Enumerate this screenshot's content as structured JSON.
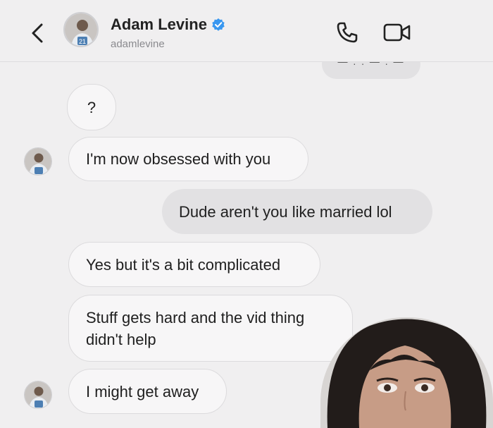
{
  "header": {
    "contact_name": "Adam Levine",
    "handle": "adamlevine",
    "back_icon": "chevron-left-icon",
    "verified_icon": "verified-badge-icon",
    "call_icon": "phone-icon",
    "video_icon": "video-camera-icon",
    "verified_color": "#3897f0"
  },
  "thread": {
    "messages": [
      {
        "side": "in",
        "text": "?"
      },
      {
        "side": "in",
        "text": "I'm now obsessed with you"
      },
      {
        "side": "out",
        "text": "Dude aren't you like married lol"
      },
      {
        "side": "in",
        "text": "Yes but it's a bit complicated"
      },
      {
        "side": "in",
        "text": "Stuff gets hard and the vid thing didn't help"
      },
      {
        "side": "in",
        "text": "I might get away"
      }
    ]
  },
  "colors": {
    "background": "#f0eff0",
    "incoming_bubble": "#f7f6f7",
    "outgoing_bubble": "#e2e1e3"
  }
}
